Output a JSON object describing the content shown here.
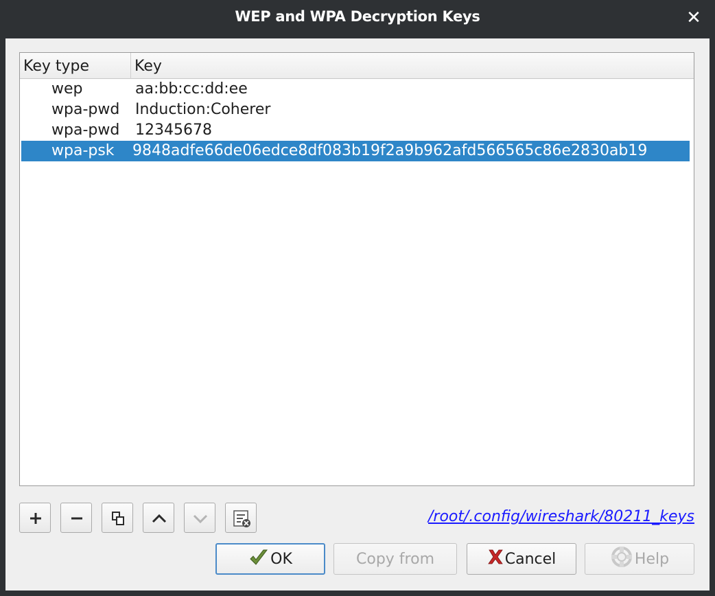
{
  "window": {
    "title": "WEP and WPA Decryption Keys"
  },
  "table": {
    "columns": [
      "Key type",
      "Key"
    ],
    "rows": [
      {
        "type": "wep",
        "key": "aa:bb:cc:dd:ee"
      },
      {
        "type": "wpa-pwd",
        "key": "Induction:Coherer"
      },
      {
        "type": "wpa-pwd",
        "key": "12345678"
      },
      {
        "type": "wpa-psk",
        "key": "9848adfe66de06edce8df083b19f2a9b962afd566565c86e2830ab19",
        "selected": true
      }
    ]
  },
  "toolbar": {
    "buttons": [
      "add",
      "remove",
      "copy",
      "move-up",
      "move-down",
      "clear"
    ]
  },
  "path": "/root/.config/wireshark/80211_keys",
  "buttons": {
    "ok": "OK",
    "copy_from": "Copy from",
    "cancel": "Cancel",
    "help": "Help"
  },
  "colors": {
    "selection": "#2e86c8",
    "link": "#1a1aff",
    "titlebar": "#2e3134"
  }
}
